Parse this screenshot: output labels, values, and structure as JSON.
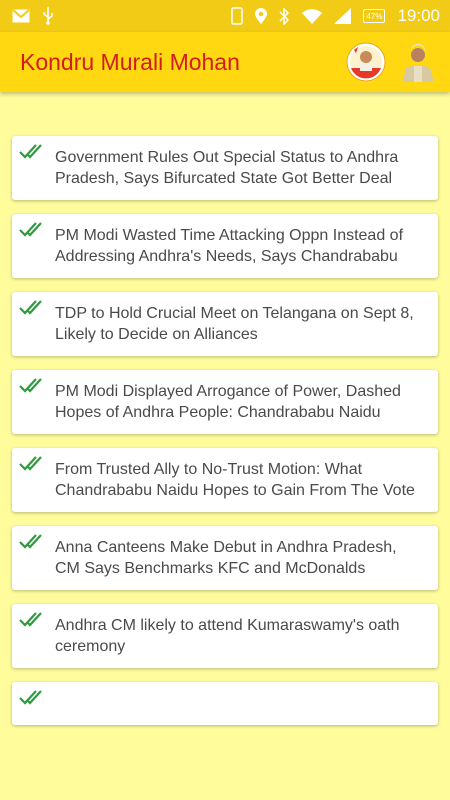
{
  "status_bar": {
    "time": "19:00",
    "battery": "47%",
    "left_icons": [
      "gmail-icon",
      "usb-icon"
    ],
    "right_icons": [
      "phone-icon",
      "location-icon",
      "bluetooth-icon",
      "wifi-icon",
      "signal-icon",
      "battery-icon"
    ]
  },
  "app_bar": {
    "title": "Kondru Murali Mohan",
    "title_color": "#d21d1d",
    "background": "#ffd812"
  },
  "feed": {
    "items": [
      {
        "title": "Government Rules Out Special Status to Andhra Pradesh, Says Bifurcated State Got Better Deal"
      },
      {
        "title": "PM Modi Wasted Time Attacking Oppn Instead of Addressing Andhra's Needs, Says Chandrababu"
      },
      {
        "title": "TDP to Hold Crucial Meet on Telangana on Sept 8, Likely to Decide on Alliances"
      },
      {
        "title": "PM Modi Displayed Arrogance of Power, Dashed Hopes of Andhra People: Chandrababu Naidu"
      },
      {
        "title": "From Trusted Ally to No-Trust Motion: What Chandrababu Naidu Hopes to Gain From The Vote"
      },
      {
        "title": "Anna Canteens Make Debut in Andhra Pradesh, CM Says Benchmarks KFC and McDonalds"
      },
      {
        "title": "Andhra CM likely to attend Kumaraswamy's oath ceremony"
      },
      {
        "title": ""
      }
    ]
  }
}
